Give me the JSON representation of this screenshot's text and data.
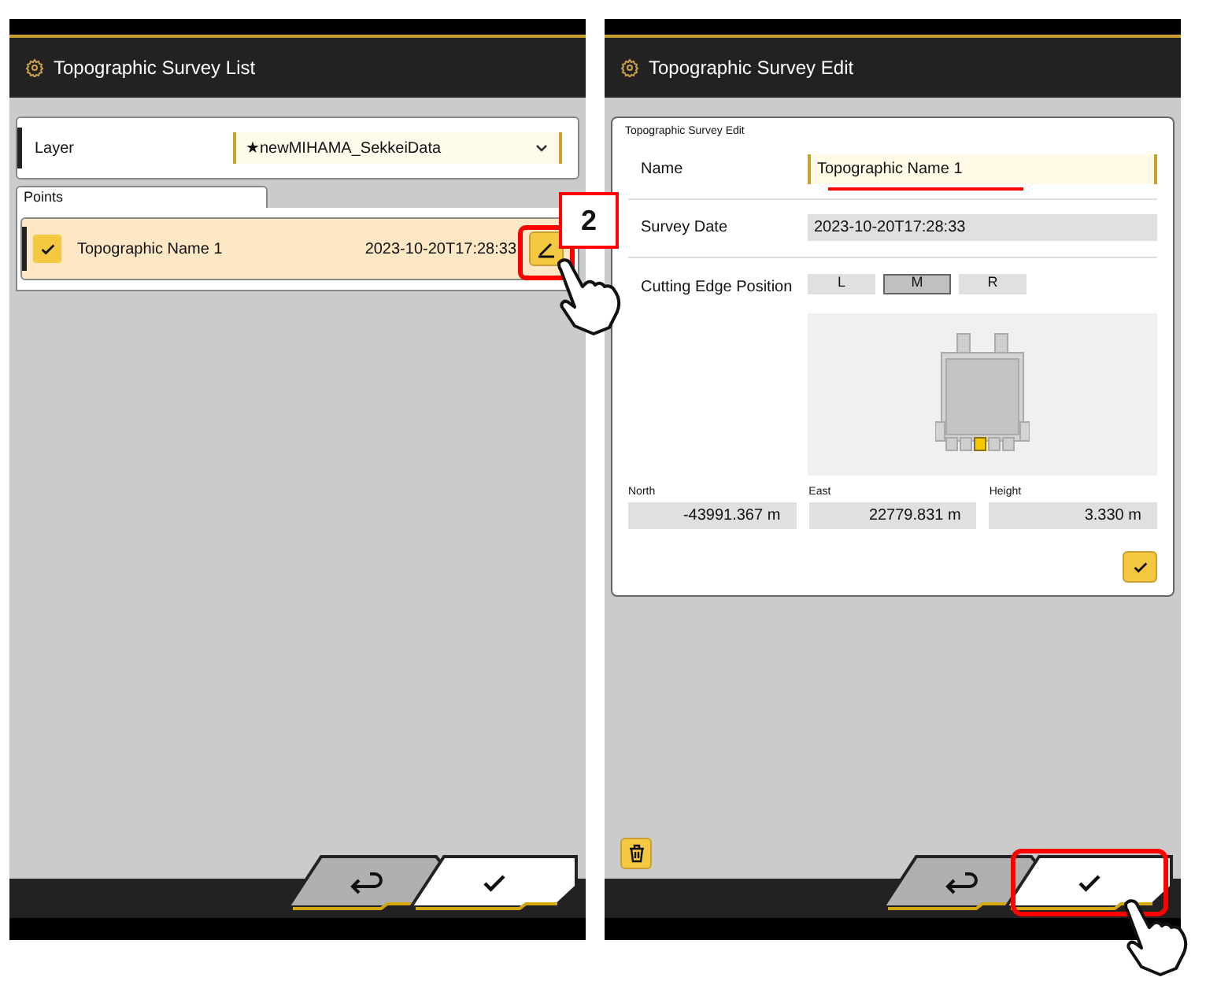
{
  "list_screen": {
    "title": "Topographic Survey List",
    "layer": {
      "label": "Layer",
      "value": "★newMIHAMA_SekkeiData"
    },
    "points": {
      "tab": "Points",
      "rows": [
        {
          "name": "Topographic Name 1",
          "date": "2023-10-20T17:28:33",
          "checked": true,
          "selected": true
        }
      ]
    }
  },
  "edit_screen": {
    "title": "Topographic Survey Edit",
    "card_title": "Topographic Survey Edit",
    "name": {
      "label": "Name",
      "value": "Topographic Name 1"
    },
    "survey_date": {
      "label": "Survey Date",
      "value": "2023-10-20T17:28:33"
    },
    "cutting_edge": {
      "label": "Cutting Edge Position",
      "options": [
        {
          "label": "L",
          "selected": false
        },
        {
          "label": "M",
          "selected": true
        },
        {
          "label": "R",
          "selected": false
        }
      ]
    },
    "coordinates": [
      {
        "label": "North",
        "value": "-43991.367 m"
      },
      {
        "label": "East",
        "value": "22779.831 m"
      },
      {
        "label": "Height",
        "value": "3.330 m"
      }
    ]
  },
  "annotations": {
    "step_label": "2"
  }
}
